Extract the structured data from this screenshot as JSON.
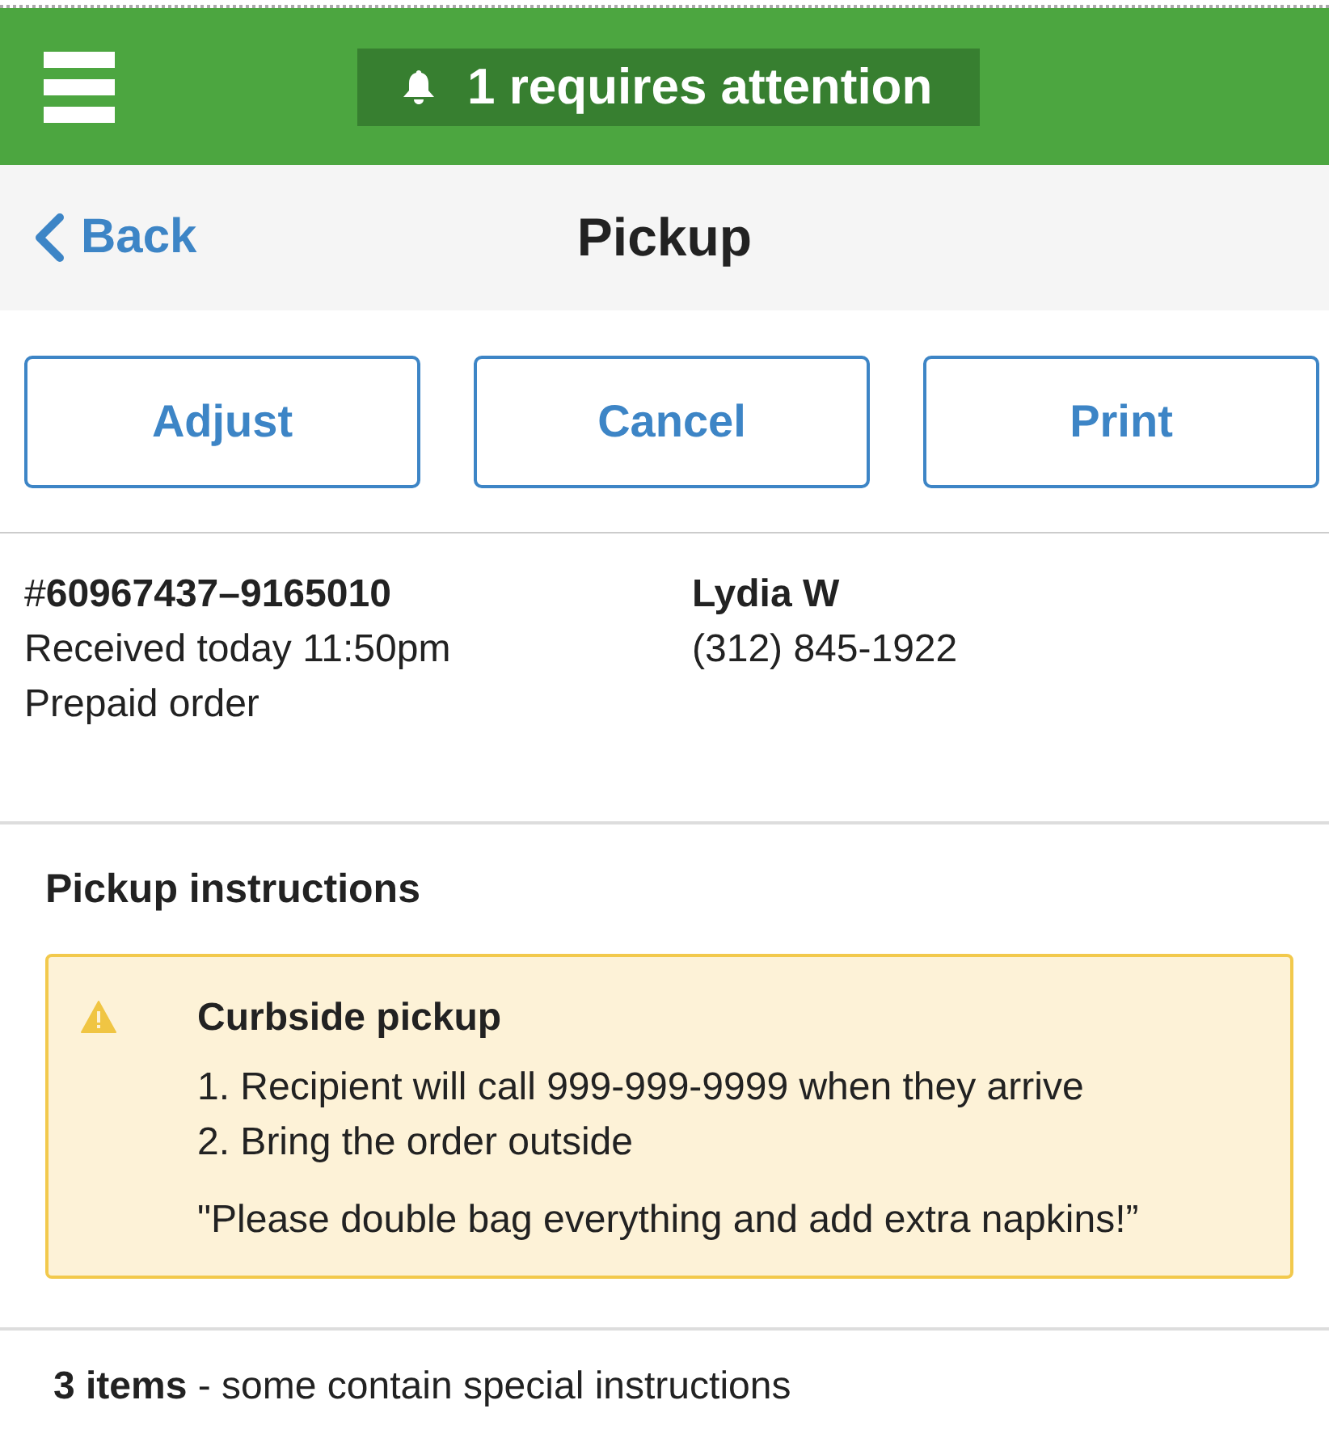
{
  "header": {
    "attention": {
      "text": "1 requires attention"
    }
  },
  "nav": {
    "back_label": "Back",
    "title": "Pickup"
  },
  "actions": [
    {
      "label": "Adjust"
    },
    {
      "label": "Cancel"
    },
    {
      "label": "Print"
    }
  ],
  "order": {
    "number": "#**60967437–9165010**",
    "received": "Received today 11:50pm",
    "payment": "Prepaid order",
    "customer": {
      "name": "Lydia W",
      "phone": "(312) 845-1922"
    }
  },
  "pickup_instructions": {
    "heading": "Pickup instructions",
    "alert": {
      "kind": "warning",
      "title": "Curbside pickup",
      "steps": [
        "1. Recipient will call 999-999-9999 when they arrive",
        "2. Bring the order outside"
      ],
      "note": "\"Please double bag everything and add extra napkins!”"
    }
  },
  "items_summary": "**3 items** - some contain special instructions"
}
